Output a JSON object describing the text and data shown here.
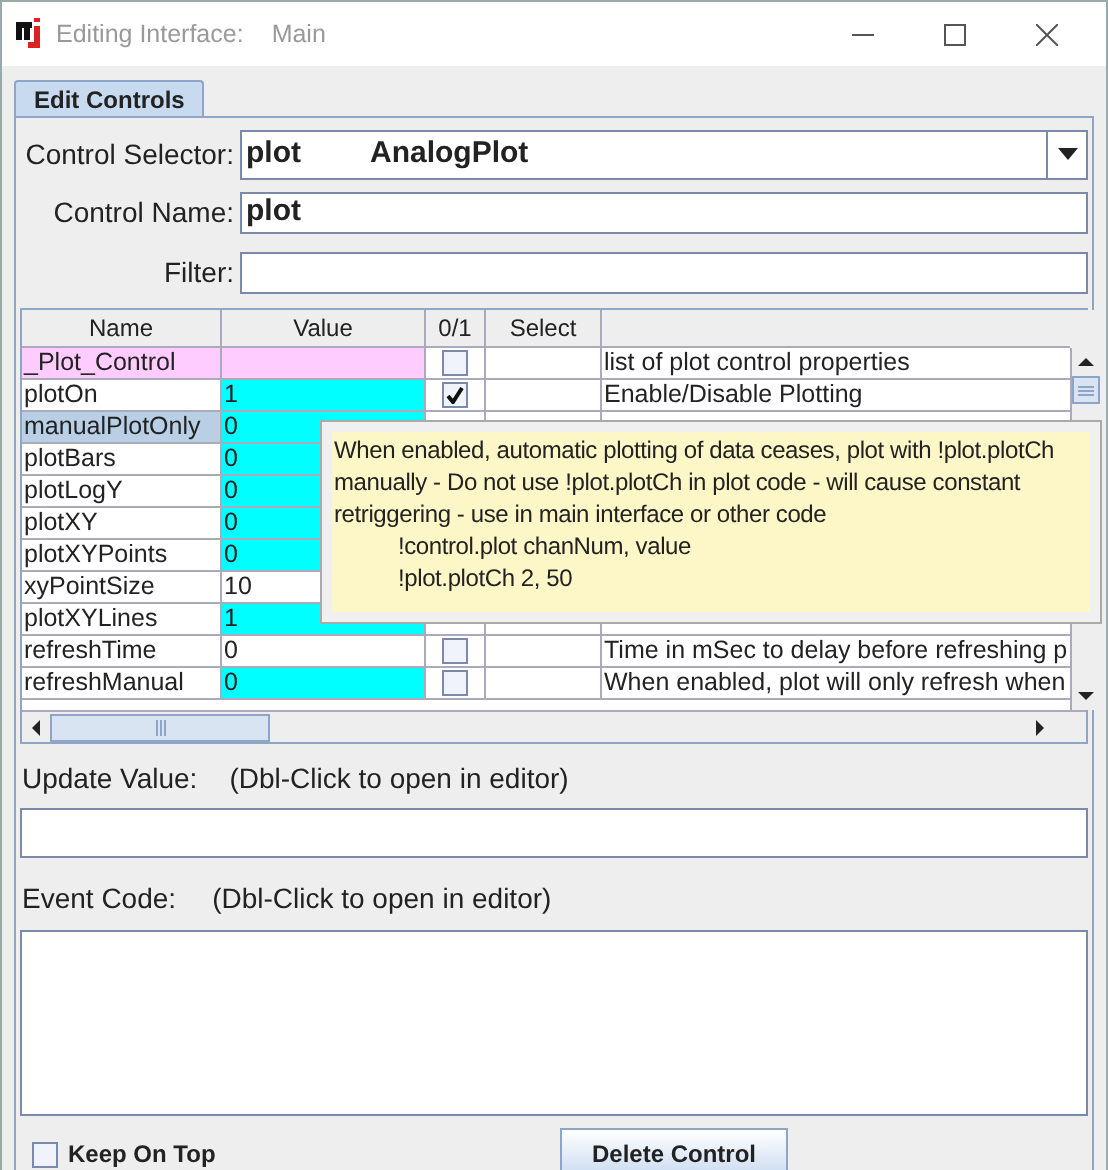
{
  "window": {
    "title": "Editing Interface:",
    "subtitle": "Main"
  },
  "tabs": [
    {
      "label": "Edit Controls",
      "selected": true
    }
  ],
  "control_selector": {
    "label": "Control Selector:",
    "value": "plot",
    "type": "AnalogPlot"
  },
  "control_name": {
    "label": "Control Name:",
    "value": "plot"
  },
  "filter": {
    "label": "Filter:"
  },
  "table": {
    "columns": [
      "Name",
      "Value",
      "0/1",
      "Select"
    ],
    "rows": [
      {
        "kind": "header",
        "name": "_Plot_Control",
        "value": "",
        "color": "#ffccff",
        "selected": false,
        "checked": false,
        "description": "list of plot control properties"
      },
      {
        "kind": "property",
        "name": "plotOn",
        "value": "1",
        "color": "#00ffff",
        "selected": false,
        "checked": true,
        "description": "Enable/Disable Plotting"
      },
      {
        "kind": "property",
        "name": "manualPlotOnly",
        "value": "0",
        "color": "#00ffff",
        "selected": true
      },
      {
        "kind": "property",
        "name": "plotBars",
        "value": "0",
        "color": "#00ffff",
        "selected": false
      },
      {
        "kind": "property",
        "name": "plotLogY",
        "value": "0",
        "color": "#00ffff",
        "selected": false
      },
      {
        "kind": "property",
        "name": "plotXY",
        "value": "0",
        "color": "#00ffff",
        "selected": false
      },
      {
        "kind": "property",
        "name": "plotXYPoints",
        "value": "0",
        "color": "#00ffff",
        "selected": false
      },
      {
        "kind": "property",
        "name": "xyPointSize",
        "value": "10",
        "color": "#ffffff",
        "selected": false
      },
      {
        "kind": "property",
        "name": "plotXYLines",
        "value": "1",
        "color": "#00ffff",
        "selected": false
      },
      {
        "kind": "property",
        "name": "refreshTime",
        "value": "0",
        "color": "#ffffff",
        "selected": false,
        "checked": false,
        "description": "Time in mSec to delay before refreshing p"
      },
      {
        "kind": "property",
        "name": "refreshManual",
        "value": "0",
        "color": "#00ffff",
        "selected": false,
        "checked": false,
        "description": "When enabled, plot will only refresh when"
      }
    ]
  },
  "tooltip": {
    "lines": [
      {
        "kind": "text",
        "text": "When enabled, automatic plotting of data ceases, plot with !plot.plotCh"
      },
      {
        "kind": "text",
        "text": "manually - Do not use !plot.plotCh in plot code - will cause constant"
      },
      {
        "kind": "text",
        "text": "retriggering - use in main interface or other code"
      },
      {
        "kind": "code",
        "text": "!control.plot chanNum, value"
      },
      {
        "kind": "code",
        "text": "!plot.plotCh 2, 50"
      }
    ]
  },
  "update_value": {
    "label": "Update Value:",
    "hint": "(Dbl-Click to open in editor)"
  },
  "event_code": {
    "label": "Event Code:",
    "hint": "(Dbl-Click to open in editor)"
  },
  "keep_on_top": {
    "label": "Keep On Top",
    "checked": false
  },
  "buttons": [
    "Delete Control"
  ]
}
